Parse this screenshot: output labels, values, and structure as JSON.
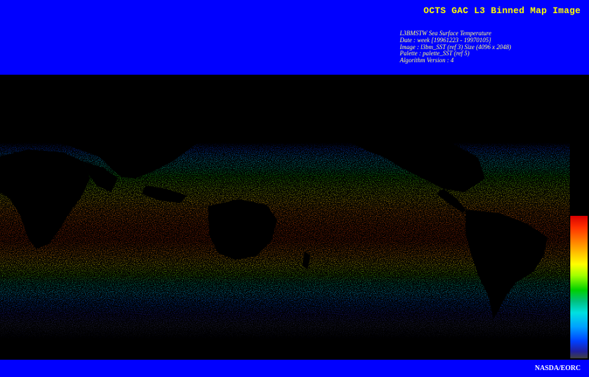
{
  "header": {
    "title": "OCTS GAC L3 Binned Map Image",
    "info_lines": [
      "L3BMSTW Sea Surface Temperature",
      "Date : week [19961223 - 19970105]",
      "Image : l3bm_SST (ref 3) Size (4096 x 2048)",
      "Palette : palette_SST (ref 5)",
      "Algorithm Version : 4"
    ]
  },
  "footer": {
    "credit": "NASDA/EORC"
  },
  "colors": {
    "banner": "#0000ff",
    "title_text": "#ffff00",
    "info_text": "#ffff80",
    "land": "#000000",
    "colorbar_top": "#d80000",
    "colorbar_bottom": "#404040"
  }
}
